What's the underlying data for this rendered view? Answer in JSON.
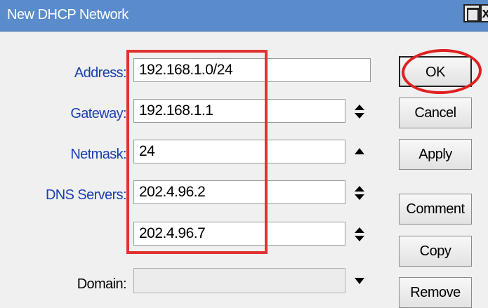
{
  "window": {
    "title": "New DHCP Network"
  },
  "form": {
    "address_label": "Address:",
    "address_value": "192.168.1.0/24",
    "gateway_label": "Gateway:",
    "gateway_value": "192.168.1.1",
    "netmask_label": "Netmask:",
    "netmask_value": "24",
    "dns_label": "DNS Servers:",
    "dns1_value": "202.4.96.2",
    "dns2_value": "202.4.96.7",
    "domain_label": "Domain:",
    "domain_value": ""
  },
  "buttons": {
    "ok": "OK",
    "cancel": "Cancel",
    "apply": "Apply",
    "comment": "Comment",
    "copy": "Copy",
    "remove": "Remove"
  },
  "icons": {
    "updown": "up-down-arrows-icon",
    "up": "up-arrow-icon",
    "down": "down-arrow-icon"
  },
  "colors": {
    "titlebar": "#5a8ccc",
    "label_blue": "#1a3fb0",
    "highlight_red": "#e23232"
  }
}
